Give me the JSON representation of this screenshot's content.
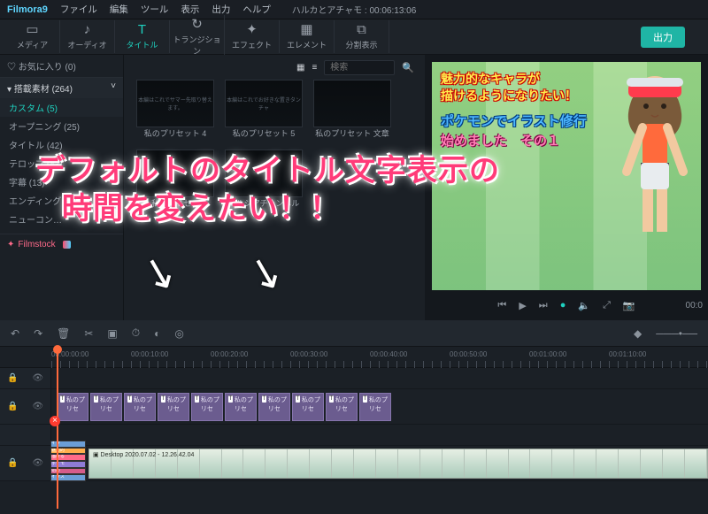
{
  "app": {
    "name": "Filmora9",
    "doc_title": "ハルカとアチャモ : 00:06:13:06"
  },
  "menubar": [
    "ファイル",
    "編集",
    "ツール",
    "表示",
    "出力",
    "ヘルプ"
  ],
  "modes": [
    {
      "icon": "▭",
      "label": "メディア"
    },
    {
      "icon": "♪",
      "label": "オーディオ"
    },
    {
      "icon": "T",
      "label": "タイトル"
    },
    {
      "icon": "↻",
      "label": "トランジション"
    },
    {
      "icon": "✦",
      "label": "エフェクト"
    },
    {
      "icon": "▦",
      "label": "エレメント"
    },
    {
      "icon": "⧉",
      "label": "分割表示"
    }
  ],
  "active_mode_index": 2,
  "export_label": "出力",
  "sidebar": {
    "fav": "お気に入り (0)",
    "cat_head": "搭載素材 (264)",
    "items": [
      {
        "label": "カスタム (5)",
        "active": true
      },
      {
        "label": "オープニング (25)"
      },
      {
        "label": "タイトル (42)"
      },
      {
        "label": "テロップ (43)"
      },
      {
        "label": "字幕 (13)"
      },
      {
        "label": "エンディング (14)"
      },
      {
        "label": "ニューコン…"
      }
    ],
    "stock": "Filmstock"
  },
  "search": {
    "placeholder": "検索"
  },
  "assets": {
    "items": [
      {
        "label": "私のプリセット 4",
        "hint": "本編はこれでサマー先取り替えます。"
      },
      {
        "label": "私のプリセット 5",
        "hint": "本編はこれでお好きな置きタンチャ"
      },
      {
        "label": "私のプリセット 文章",
        "hint": ""
      },
      {
        "label": "私のプリセ…",
        "hint": ""
      },
      {
        "label": "海ルシアチャンネル",
        "hint": ""
      }
    ]
  },
  "preview": {
    "line1a": "魅力的なキャラが",
    "line1b": "描けるようになりたい！",
    "line2": "ポケモンでイラスト修行",
    "line3": "始めました　その１",
    "time": "00:0"
  },
  "overlay": {
    "line1": "デフォルトのタイトル文字表示の",
    "line2": "時間を変えたい！！"
  },
  "timeline": {
    "ruler": [
      "00:00:00:00",
      "00:00:10:00",
      "00:00:20:00",
      "00:00:30:00",
      "00:00:40:00",
      "00:00:50:00",
      "00:01:00:00",
      "00:01:10:00"
    ],
    "title_clip_label": "私のプリセ",
    "title_clip_count": 10,
    "title_clip_width": 38,
    "video_clip_label": "Desktop 2020.07.02 - 12.26.42.04",
    "monitor_time": "00:0"
  }
}
